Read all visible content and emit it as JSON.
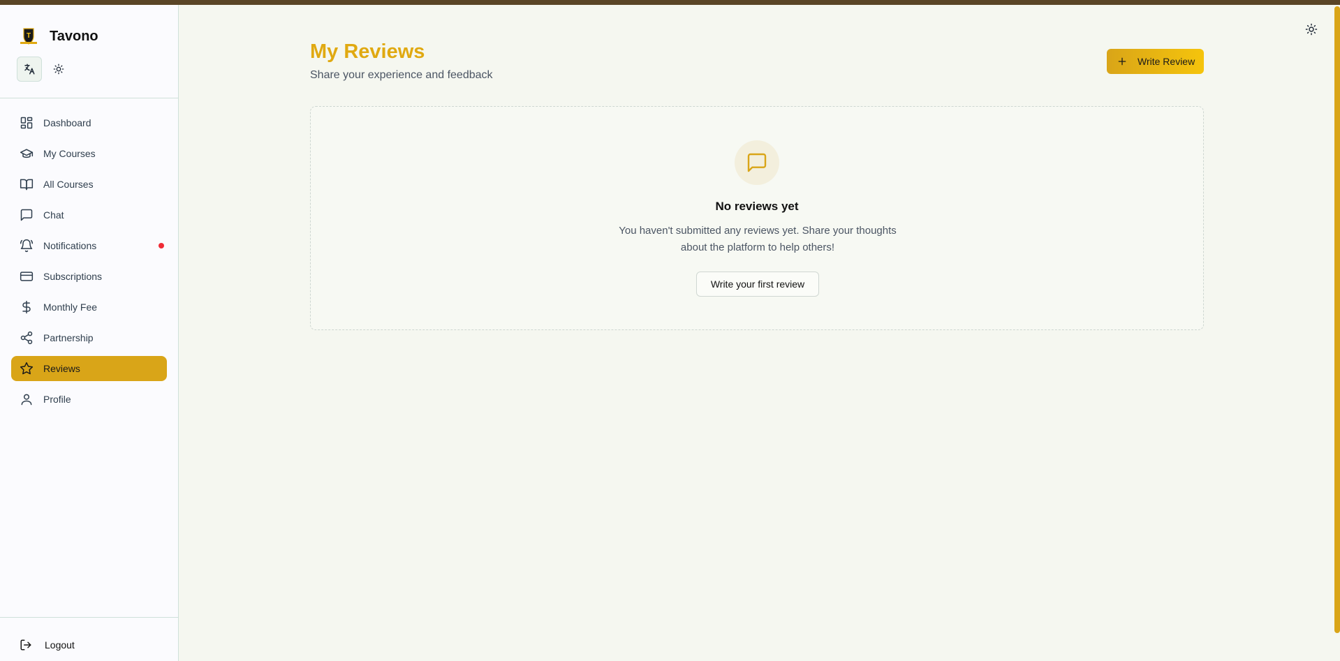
{
  "brand": {
    "name": "Tavono"
  },
  "sidebar": {
    "items": [
      {
        "label": "Dashboard",
        "icon": "dashboard-icon"
      },
      {
        "label": "My Courses",
        "icon": "graduation-cap-icon"
      },
      {
        "label": "All Courses",
        "icon": "book-open-icon"
      },
      {
        "label": "Chat",
        "icon": "chat-icon"
      },
      {
        "label": "Notifications",
        "icon": "bell-icon"
      },
      {
        "label": "Subscriptions",
        "icon": "credit-card-icon"
      },
      {
        "label": "Monthly Fee",
        "icon": "dollar-icon"
      },
      {
        "label": "Partnership",
        "icon": "share-icon"
      },
      {
        "label": "Reviews",
        "icon": "star-icon"
      },
      {
        "label": "Profile",
        "icon": "user-icon"
      }
    ],
    "active": "Reviews",
    "logout_label": "Logout"
  },
  "header": {
    "title": "My Reviews",
    "subtitle": "Share your experience and feedback",
    "write_button_label": "Write Review"
  },
  "empty_state": {
    "title": "No reviews yet",
    "message": "You haven't submitted any reviews yet. Share your thoughts about the platform to help others!",
    "button_label": "Write your first review"
  },
  "colors": {
    "accent": "#d9a518",
    "title": "#e0a911",
    "top_bar": "#5a4526",
    "notification_dot": "#ef2b36"
  }
}
